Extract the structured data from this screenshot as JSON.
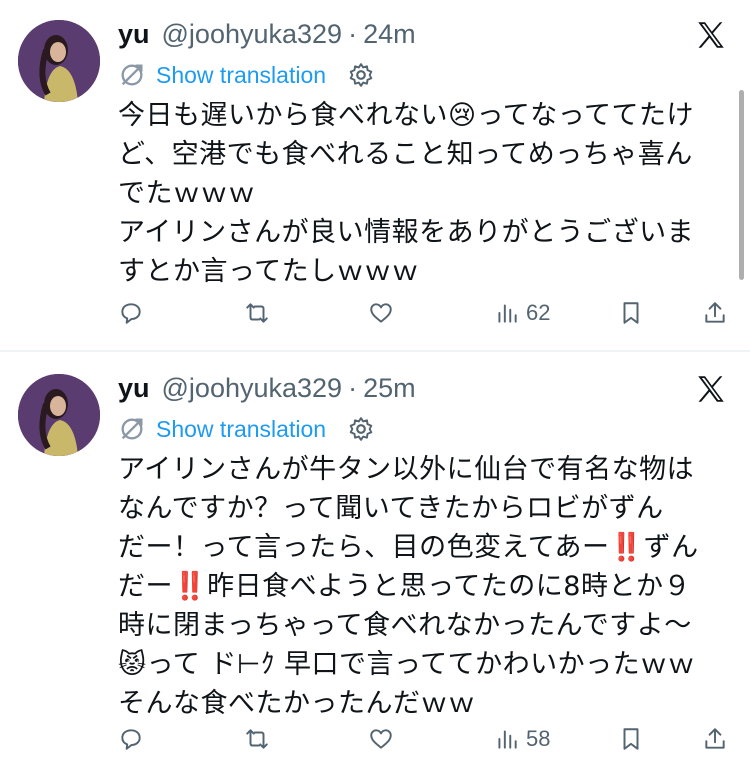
{
  "tweets": [
    {
      "author_name": "yu",
      "handle": "@joohyuka329",
      "separator": "·",
      "time": "24m",
      "translate_label": "Show translation",
      "lines": [
        "今日も遅いから食べれない😢ってなっててたけ",
        "ど、空港でも食べれること知ってめっちゃ喜ん",
        "でたｗｗｗ",
        "アイリンさんが良い情報をありがとうございま",
        "すとか言ってたしｗｗｗ"
      ],
      "views": "62"
    },
    {
      "author_name": "yu",
      "handle": "@joohyuka329",
      "separator": "·",
      "time": "25m",
      "translate_label": "Show translation",
      "lines": [
        "アイリンさんが牛タン以外に仙台で有名な物は",
        "なんですか？って聞いてきたからロビがずん",
        "だー！って言ったら、目の色変えてあー‼️ずん",
        "だー‼️昨日食べようと思ってたのに8時とか９",
        "時に閉まっちゃって食べれなかったんですよ～",
        "😾って ド⊢ｸ 早口で言っててかわいかったｗｗ",
        "そんな食べたかったんだｗｗ"
      ],
      "views": "58"
    }
  ],
  "icons": {
    "platform_logo": "x-logo-icon",
    "translate": "translate-icon",
    "settings": "gear-icon",
    "reply": "reply-icon",
    "repost": "repost-icon",
    "like": "like-icon",
    "views": "views-icon",
    "bookmark": "bookmark-icon",
    "share": "share-icon"
  },
  "colors": {
    "text": "#0f1419",
    "secondary": "#536471",
    "link": "#1d9bf0",
    "divider": "#eff3f4"
  }
}
